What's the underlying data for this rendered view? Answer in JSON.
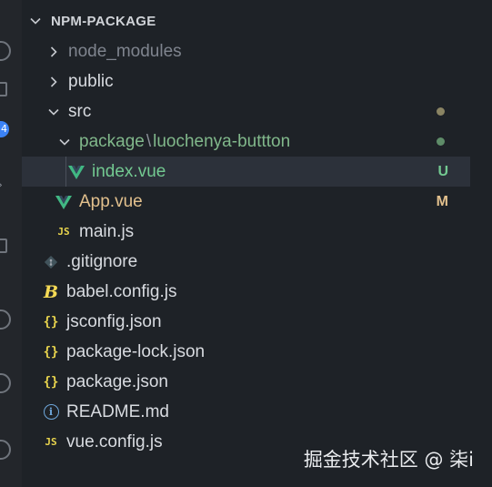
{
  "explorer": {
    "section_title": "NPM-PACKAGE"
  },
  "activity_bar": {
    "badge_count": "4"
  },
  "tree": {
    "node_modules": "node_modules",
    "public": "public",
    "src": "src",
    "package_folder": "package",
    "package_separator": "\\",
    "package_subfolder": "luochenya-buttton",
    "index_vue": "index.vue",
    "index_vue_status": "U",
    "app_vue": "App.vue",
    "app_vue_status": "M",
    "main_js": "main.js",
    "gitignore": ".gitignore",
    "babel_config": "babel.config.js",
    "jsconfig": "jsconfig.json",
    "package_lock": "package-lock.json",
    "package_json": "package.json",
    "readme": "README.md",
    "vue_config": "vue.config.js"
  },
  "icons": {
    "js_badge": "JS",
    "json_braces": "{}",
    "info": "i",
    "babel": "B"
  },
  "colors": {
    "untracked": "#73c991",
    "modified": "#e2c08d",
    "vue": "#41b883",
    "js": "#e8d44d"
  },
  "watermark": "掘金技术社区 @ 柒i"
}
